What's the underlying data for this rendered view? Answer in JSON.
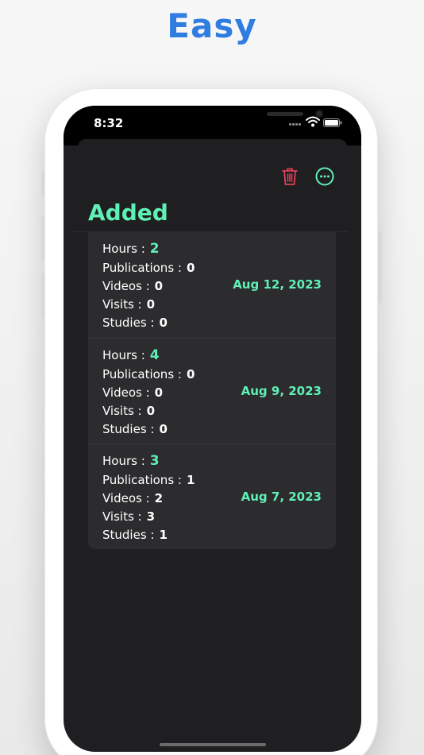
{
  "promo": {
    "headline": "Easy"
  },
  "status_bar": {
    "time": "8:32",
    "icons": [
      "cellular-icon",
      "wifi-icon",
      "battery-icon"
    ]
  },
  "toolbar": {
    "icons": [
      "trash-icon",
      "more-icon"
    ]
  },
  "page": {
    "title": "Added"
  },
  "labels": {
    "hours": "Hours :",
    "publications": "Publications :",
    "videos": "Videos :",
    "visits": "Visits :",
    "studies": "Studies :"
  },
  "entries": [
    {
      "hours": "2",
      "publications": "0",
      "videos": "0",
      "visits": "0",
      "studies": "0",
      "date": "Aug 12, 2023"
    },
    {
      "hours": "4",
      "publications": "0",
      "videos": "0",
      "visits": "0",
      "studies": "0",
      "date": "Aug 9, 2023"
    },
    {
      "hours": "3",
      "publications": "1",
      "videos": "2",
      "visits": "3",
      "studies": "1",
      "date": "Aug 7, 2023"
    }
  ],
  "colors": {
    "accent": "#5ff0b6",
    "headline": "#2f7de1",
    "delete": "#e0405a",
    "background": "#1f1f21",
    "card": "#2c2c2e"
  }
}
